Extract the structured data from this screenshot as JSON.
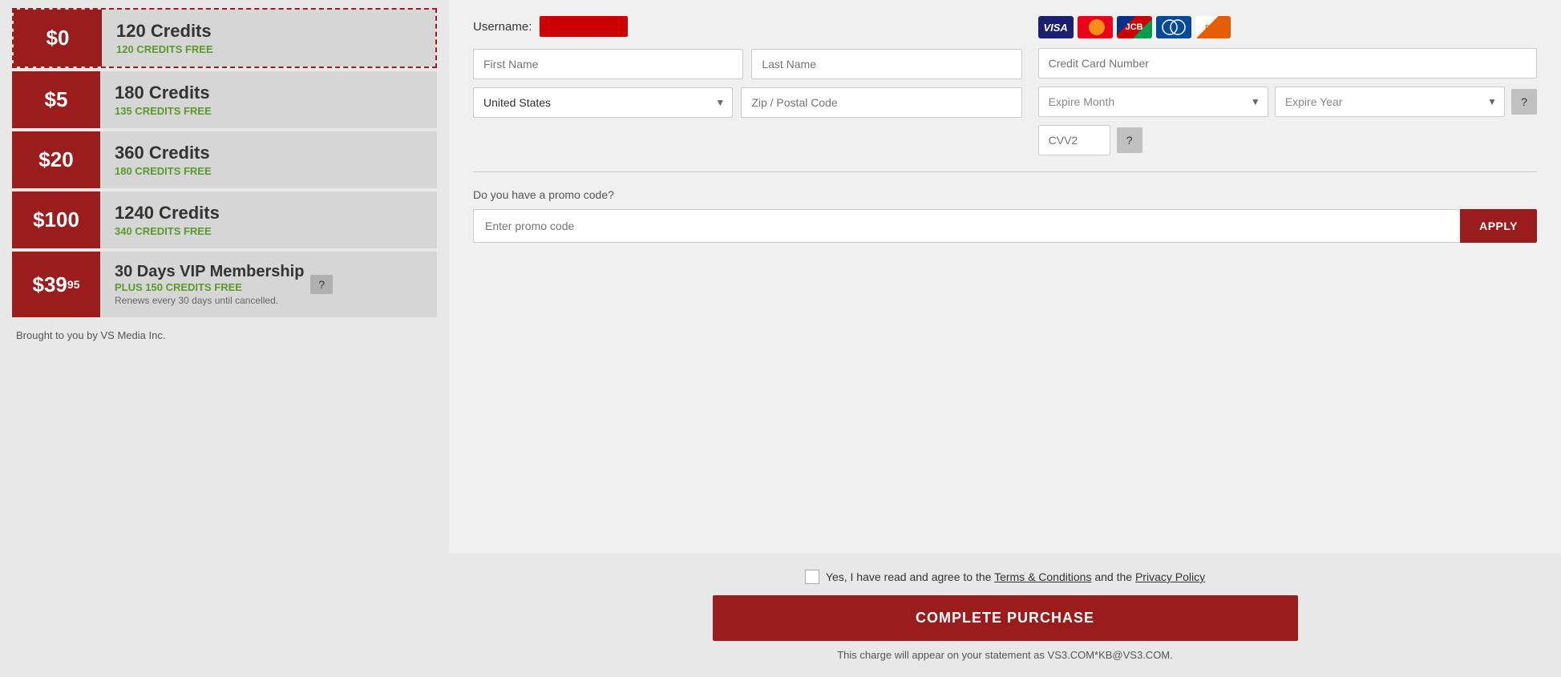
{
  "packages": [
    {
      "id": "pkg-0",
      "price": "$0",
      "credits_main": "120 Credits",
      "credits_free": "120 CREDITS FREE",
      "selected": true
    },
    {
      "id": "pkg-5",
      "price": "$5",
      "credits_main": "180 Credits",
      "credits_free": "135 CREDITS FREE",
      "selected": false
    },
    {
      "id": "pkg-20",
      "price": "$20",
      "credits_main": "360 Credits",
      "credits_free": "180 CREDITS FREE",
      "selected": false
    },
    {
      "id": "pkg-100",
      "price": "$100",
      "credits_main": "1240 Credits",
      "credits_free": "340 CREDITS FREE",
      "selected": false
    }
  ],
  "vip": {
    "price_main": "$39",
    "price_sup": "95",
    "title": "30 Days VIP Membership",
    "free_credits": "PLUS 150 CREDITS FREE",
    "renew_text": "Renews every 30 days until cancelled."
  },
  "brought_by": "Brought to you by VS Media Inc.",
  "form": {
    "username_label": "Username:",
    "first_name_placeholder": "First Name",
    "last_name_placeholder": "Last Name",
    "country_value": "United States",
    "zip_placeholder": "Zip / Postal Code",
    "cc_placeholder": "Credit Card Number",
    "expire_month_placeholder": "Expire Month",
    "expire_year_placeholder": "Expire Year",
    "cvv2_placeholder": "CVV2"
  },
  "card_icons": [
    {
      "name": "visa",
      "label": "VISA"
    },
    {
      "name": "mastercard",
      "label": "MC"
    },
    {
      "name": "jcb",
      "label": "JCB"
    },
    {
      "name": "diners",
      "label": "DC"
    },
    {
      "name": "discover",
      "label": "DISC"
    }
  ],
  "promo": {
    "label": "Do you have a promo code?",
    "placeholder": "Enter promo code",
    "apply_label": "APPLY"
  },
  "terms": {
    "text_before": "Yes, I have read and agree to the ",
    "terms_link": "Terms & Conditions",
    "text_middle": " and the ",
    "privacy_link": "Privacy Policy"
  },
  "complete_btn": "COMPLETE PURCHASE",
  "statement_text": "This charge will appear on your statement as VS3.COM*KB@VS3.COM."
}
